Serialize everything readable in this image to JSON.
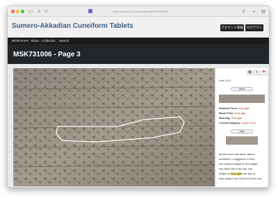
{
  "browser": {
    "url": "etcsl.orinst.ox.ac.uk/cuneiform/MSK731006/3",
    "nav_back": "<",
    "nav_forward": ">",
    "share_icon": "⇪",
    "add_tab": "+",
    "tabs_icon": "⧉"
  },
  "site": {
    "title": "Sumero-Akkadian Cuneiform Tablets",
    "account_button": "アカウント情報",
    "logout_button": "ログアウト"
  },
  "nav": {
    "items": [
      "WOB Home",
      "About",
      "Collection",
      "Search"
    ]
  },
  "page": {
    "title": "MSK731006 - Page 3"
  },
  "sidebar": {
    "line_info": "Line: 29-4",
    "word_pill": "Word",
    "realized_label": "Realized Form:",
    "realized_value": "ibuḫ-ajjar",
    "basic_label": "Basic Form:",
    "basic_value": "ibuḫ-ajjar",
    "meaning_label": "Meaning:",
    "meaning_value": "ibuḫ-ajjar",
    "lexical_label": "Lexical Category:",
    "lexical_value": "proper noun",
    "sign_pill": "Sign",
    "transliteration": [
      "ferram anum ana abum akkum",
      "anaddum; u naggaiuhu la ibuḫ-",
      "mar kaspam ibaqal la Pitu-isagen",
      "mar Abuli nilo-in ittu ibur mar",
      "ibaqal ina",
      "ibuḫ-ajjar",
      "mar ibia-ur",
      "tabu-isagen mar Kinia ib Zuzubi mar"
    ]
  },
  "colors": {
    "site_title": "#3c5f85",
    "nav_bg": "#1c1c1c",
    "band_bg": "#232629",
    "highlight": "#f3df6a",
    "red_value": "#b53b2b"
  }
}
